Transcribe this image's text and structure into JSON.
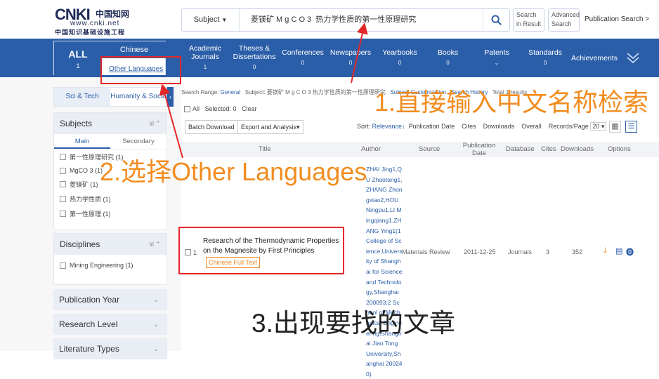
{
  "header": {
    "logo": {
      "big": "CNKI",
      "cn1": "中国知网",
      "url": "www.cnki.net",
      "cn2": "中国知识基础设施工程"
    },
    "subject_select": "Subject",
    "query": "菱镁矿 M g C O 3  热力学性质的第一性原理研究",
    "in_result_label": "Search in Result",
    "advanced_label": "Advanced Search",
    "publication_search": "Publication Search  >"
  },
  "nav": {
    "all": {
      "label": "ALL",
      "count": "1"
    },
    "chinese": "Chinese",
    "other_languages": "Other Languages",
    "items": [
      {
        "label": "Academic Journals",
        "count": "1"
      },
      {
        "label": "Theses & Dissertations",
        "count": "0"
      },
      {
        "label": "Conferences",
        "count": "0"
      },
      {
        "label": "Newspapers",
        "count": "0"
      },
      {
        "label": "Yearbooks",
        "count": "0"
      },
      {
        "label": "Books",
        "count": "0"
      },
      {
        "label": "Patents",
        "count": ""
      },
      {
        "label": "Standards",
        "count": "0"
      },
      {
        "label": "Achievements",
        "count": ""
      }
    ]
  },
  "sidebar": {
    "tabs": [
      "Sci & Tech",
      "Humanity & Social"
    ],
    "subjects": {
      "title": "Subjects",
      "subtabs": [
        "Main",
        "Secondary"
      ],
      "items": [
        "第一性原理研究 (1)",
        "MgCO 3 (1)",
        "菱镁矿 (1)",
        "热力学性质 (1)",
        "第一性原理 (1)"
      ]
    },
    "disciplines": {
      "title": "Disciplines",
      "items": [
        "Mining Engineering (1)"
      ]
    },
    "collapsed": [
      "Publication Year",
      "Research Level",
      "Literature Types"
    ]
  },
  "main": {
    "range_label": "Search Range:",
    "range_value": "General",
    "subject_label": "Subject:",
    "subject_value": "菱镁矿 M g C O 3  热力学性质的第一性原理研究",
    "subscription": "Subject Customization",
    "history": "Search History",
    "results_found": "Total 1 results",
    "toolbar": {
      "all": "All",
      "selected": "Selected: 0",
      "clear": "Clear",
      "batch": "Batch Download",
      "export": "Export and Analysis"
    },
    "sort": {
      "label": "Sort:",
      "relevance": "Relevance",
      "others": [
        "Publication Date",
        "Cites",
        "Downloads",
        "Overall"
      ],
      "records_label": "Records/Page",
      "records_value": "20"
    },
    "columns": [
      "Title",
      "Author",
      "Source",
      "Publication Date",
      "Database",
      "Cites",
      "Downloads",
      "Options"
    ],
    "row": {
      "num": "1",
      "title": "Research of the Thermodynamic Properties on the Magnesite by First Principles",
      "fulltext": "Chinese Full Text",
      "authors": "ZHAI Jing1,QU Zhaotang1,ZHANG Zhongxiao2,HOU Ningpu1,LI Mingqiang1,ZHANG Ying1(1 College of Science,University of Shanghai for Science and Technology,Shanghai 200093;2 School of Mechanical Engineering,Shanghai Jiao Tong University,Shanghai 200240)",
      "source": "Materials Review",
      "date": "2011-12-25",
      "database": "Journals",
      "cites": "3",
      "downloads": "352"
    }
  },
  "annotations": {
    "a1": "1.直接输入中文名称检索",
    "a2": "2.选择Other Languages",
    "a3": "3.出现要找的文章"
  },
  "colors": {
    "nav_blue": "#2b5ea8",
    "annotation_orange": "#f28c1f",
    "annotation_red": "#e3282a"
  }
}
